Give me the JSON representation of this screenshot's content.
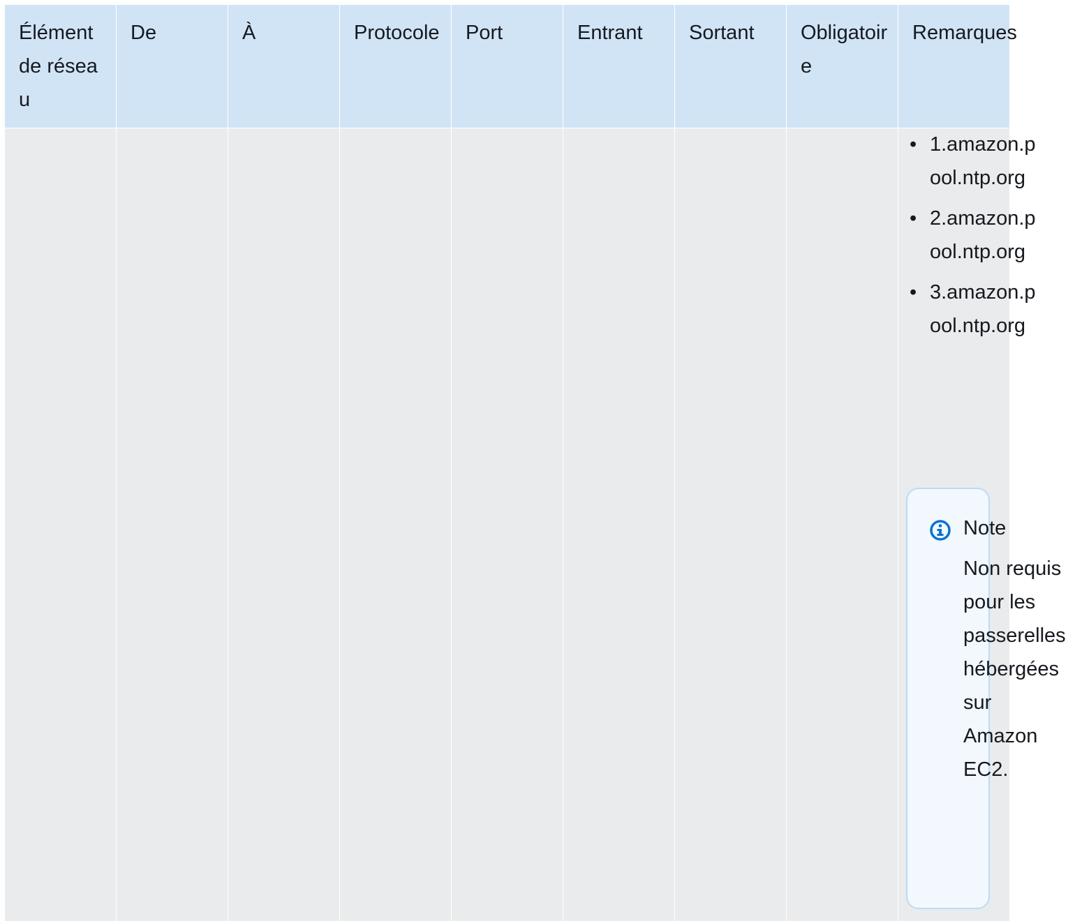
{
  "table": {
    "headers": [
      "Élément de réseau",
      "De",
      "À",
      "Protocole",
      "Port",
      "Entrant",
      "Sortant",
      "Obligatoire",
      "Remarques"
    ],
    "remarks": {
      "hosts": [
        "1.amazon.pool.ntp.org",
        "2.amazon.pool.ntp.org",
        "3.amazon.pool.ntp.org"
      ],
      "note": {
        "icon": "info-icon",
        "title": "Note",
        "text": "Non requis pour les passerelles hébergées sur Amazon EC2."
      }
    }
  },
  "colors": {
    "header_bg": "#d1e4f5",
    "body_bg": "#e9ebed",
    "note_border": "#b8dcf5",
    "note_bg": "#f2f8fd",
    "info_icon": "#0972d3"
  }
}
